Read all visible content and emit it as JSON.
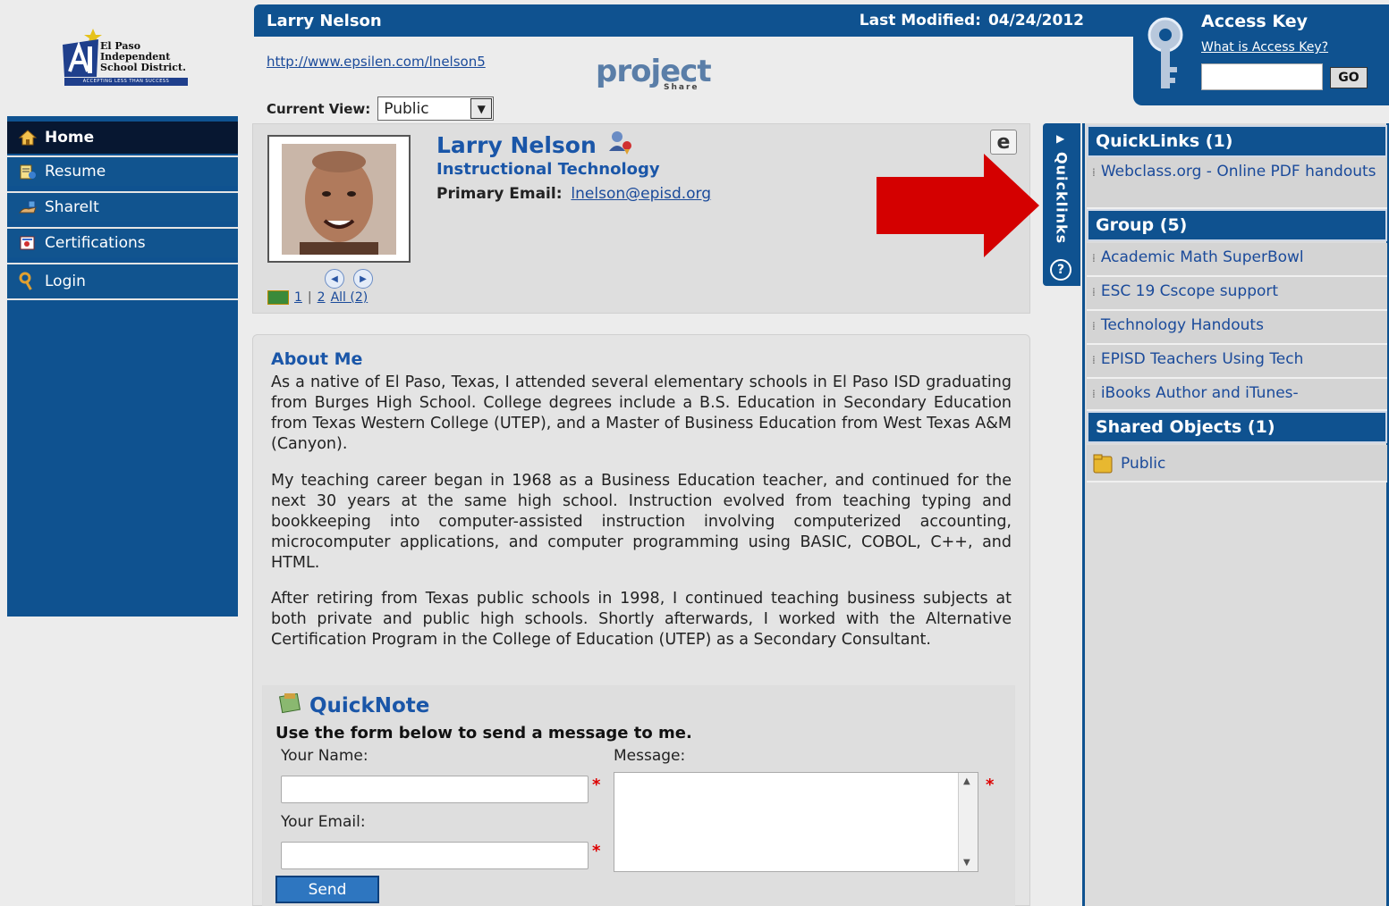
{
  "logo": {
    "line1": "El Paso",
    "line2": "Independent",
    "line3": "School District.",
    "tagline": "ACCEPTING LESS THAN SUCCESS"
  },
  "nav": {
    "items": [
      {
        "label": "Home",
        "icon": "home-icon"
      },
      {
        "label": "Resume",
        "icon": "resume-icon"
      },
      {
        "label": "ShareIt",
        "icon": "share-icon"
      },
      {
        "label": "Certifications",
        "icon": "certificate-icon"
      },
      {
        "label": "Login",
        "icon": "key-icon"
      }
    ]
  },
  "header": {
    "name": "Larry Nelson",
    "last_modified_label": "Last Modified:",
    "last_modified_date": "04/24/2012",
    "url": "http://www.epsilen.com/lnelson5"
  },
  "project_logo": {
    "word": "project",
    "sub": "Share"
  },
  "current_view": {
    "label": "Current View:",
    "value": "Public"
  },
  "access_key": {
    "title": "Access Key",
    "help_link": "What is Access Key?",
    "go": "GO"
  },
  "profile": {
    "name": "Larry Nelson",
    "department": "Instructional Technology",
    "email_label": "Primary Email:",
    "email": "lnelson@episd.org",
    "page_1": "1",
    "separator": "|",
    "page_2": "2",
    "all": "All (2)"
  },
  "quicklinks_tab": {
    "label": "Quicklinks",
    "help": "?"
  },
  "right_panel": {
    "quicklinks_header": "QuickLinks (1)",
    "quicklinks": [
      "Webclass.org - Online PDF handouts"
    ],
    "group_header": "Group (5)",
    "groups": [
      "Academic Math SuperBowl",
      "ESC 19 Cscope support",
      "Technology Handouts",
      "EPISD Teachers Using Tech",
      "iBooks Author and iTunes-"
    ],
    "shared_header": "Shared Objects (1)",
    "shared": [
      "Public"
    ]
  },
  "about": {
    "title": "About Me",
    "paragraphs": [
      "As a native of El Paso, Texas, I attended several elementary schools in El Paso ISD graduating from Burges High School.  College degrees include a B.S. Education in Secondary Education from Texas Western College (UTEP), and a Master of Business Education from West Texas A&M (Canyon).",
      "My teaching career began in 1968 as a Business Education teacher, and continued for the next 30 years at the same high school. Instruction evolved from teaching typing and bookkeeping into computer-assisted instruction involving computerized accounting, microcomputer applications, and computer programming using BASIC, COBOL, C++, and HTML.",
      "After retiring from Texas public schools in 1998, I continued teaching business subjects at both private and public high schools.  Shortly afterwards, I worked with the Alternative Certification Program in the College of Education (UTEP) as a Secondary Consultant."
    ]
  },
  "quicknote": {
    "title": "QuickNote",
    "subtitle": "Use the form below to send a message to me.",
    "name_label": "Your Name:",
    "email_label": "Your Email:",
    "message_label": "Message:",
    "required_mark": "*",
    "send": "Send"
  },
  "colors": {
    "brand_blue": "#0f5290",
    "nav_active": "#071731",
    "link": "#1a4a9a",
    "arrow_red": "#d40000"
  }
}
